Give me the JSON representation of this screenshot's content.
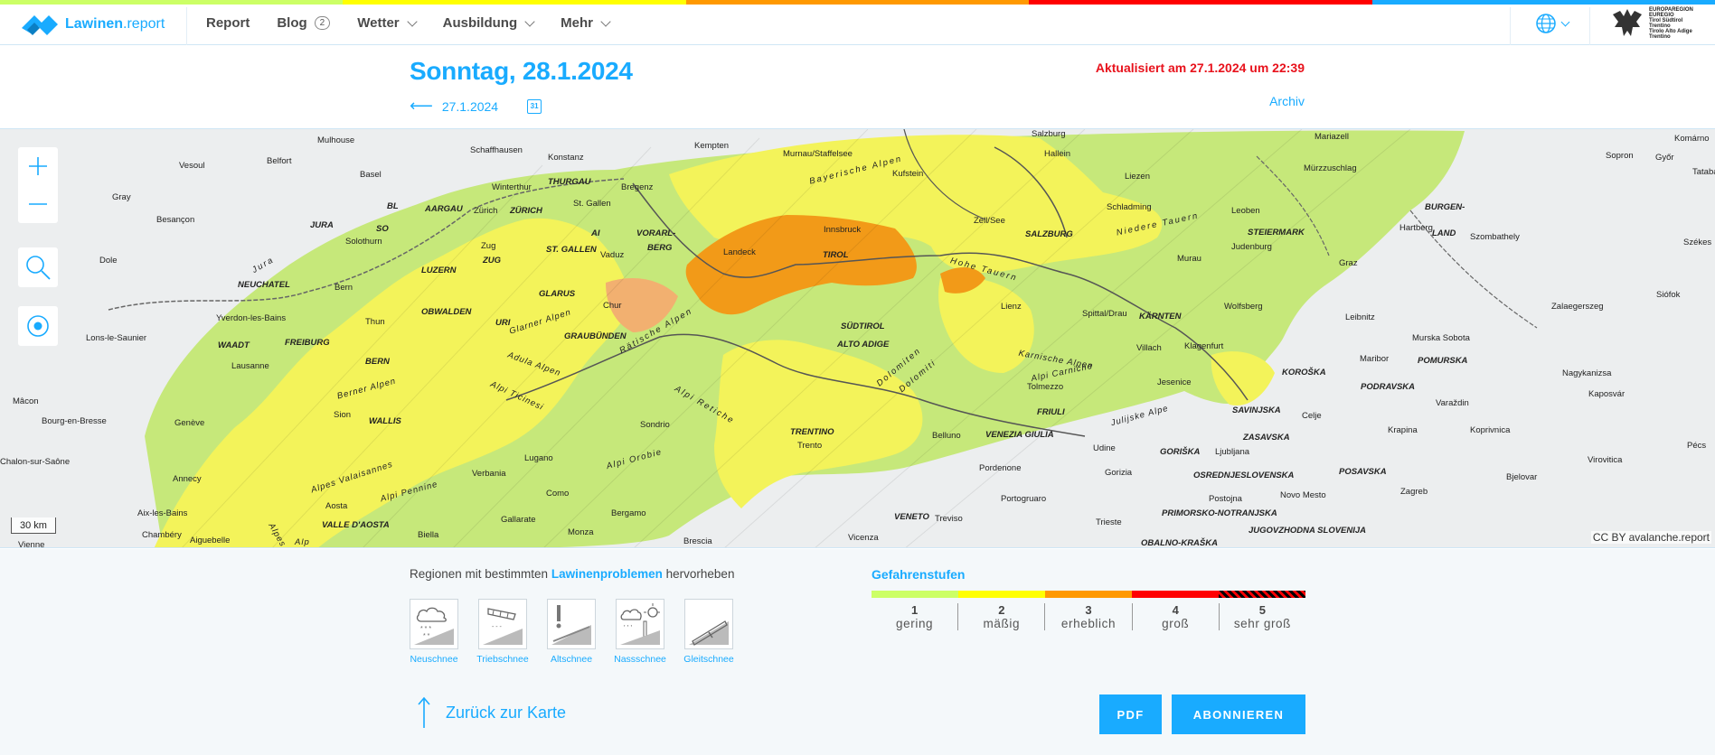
{
  "header": {
    "logo_text_main": "Lawinen",
    "logo_text_suffix": ".report",
    "nav": [
      {
        "label": "Report"
      },
      {
        "label": "Blog",
        "badge": "2"
      },
      {
        "label": "Wetter"
      },
      {
        "label": "Ausbildung"
      },
      {
        "label": "Mehr"
      }
    ],
    "strip_colors": [
      "#ccff66",
      "#ffff00",
      "#ff9900",
      "#ff0000",
      "#19abff"
    ],
    "language_icon": "globe-icon",
    "euregio_text": [
      "EUROPAREGION",
      "EUREGIO",
      "Tirol Südtirol Trentino",
      "Tirolo Alto Adige Trentino"
    ]
  },
  "report": {
    "date_title": "Sonntag, 28.1.2024",
    "prev_date": "27.1.2024",
    "calendar_day": "31",
    "updated": "Aktualisiert am 27.1.2024 um 22:39",
    "archive": "Archiv"
  },
  "map": {
    "scale": "30 km",
    "attribution": "CC BY avalanche.report",
    "labels": {
      "mulhouse": "Mulhouse",
      "belfort": "Belfort",
      "vesoul": "Vesoul",
      "basel": "Basel",
      "schaffhausen": "Schaffhausen",
      "konstanz": "Konstanz",
      "kempten": "Kempten",
      "murnau": "Murnau/Staffelsee",
      "salzburg": "Salzburg",
      "hallein": "Hallein",
      "mariazell": "Mariazell",
      "komarno": "Komárno",
      "gray": "Gray",
      "bl": "BL",
      "aargau": "AARGAU",
      "zurich": "Zürich",
      "zurich_c": "ZÜRICH",
      "winterthur": "Winterthur",
      "thurgau": "THURGAU",
      "bregenz": "Bregenz",
      "kufstein": "Kufstein",
      "liezen": "Liezen",
      "murzzuschlag": "Mürzzuschlag",
      "sopron": "Sopron",
      "gyor": "Győr",
      "tatab": "Tataba",
      "besancon": "Besançon",
      "jura": "JURA",
      "so": "SO",
      "solothurn": "Solothurn",
      "sankt_gallen": "St. Gallen",
      "ai": "AI",
      "vorarlberg": "VORARL-",
      "berg": "BERG",
      "innsbruck": "Innsbruck",
      "schladming": "Schladming",
      "leoben": "Leoben",
      "burgen": "BURGEN-",
      "land": "LAND",
      "hartberg": "Hartberg",
      "szombathely": "Szombathely",
      "zellamsee": "Zell/See",
      "salzburg_c": "SALZBURG",
      "steiermark": "STEIERMARK",
      "dole": "Dole",
      "luzern": "LUZERN",
      "zug": "Zug",
      "zug_c": "ZUG",
      "st_gallen_c": "ST. GALLEN",
      "vaduz": "Vaduz",
      "landeck": "Landeck",
      "tirol": "TIROL",
      "judenburg": "Judenburg",
      "murau": "Murau",
      "graz": "Graz",
      "szekes": "Székes",
      "neuchatel": "NEUCHATEL",
      "bern": "Bern",
      "glarus": "GLARUS",
      "chur": "Chur",
      "lienz": "Lienz",
      "spittal": "Spittal/Drau",
      "karnten": "KÄRNTEN",
      "wolfsberg": "Wolfsberg",
      "leibnitz": "Leibnitz",
      "siofok": "Siófok",
      "zalaegerszeg": "Zalaegerszeg",
      "yverdon": "Yverdon-les-Bains",
      "thun": "Thun",
      "obwalden": "OBWALDEN",
      "uri": "URI",
      "graubunden": "GRAUBÜNDEN",
      "sudtirol": "SÜDTIROL",
      "alto_adige": "ALTO ADIGE",
      "villach": "Villach",
      "klagenfurt": "Klagenfurt",
      "maribor": "Maribor",
      "murska": "Murska Sobota",
      "lons": "Lons-le-Saunier",
      "waadt": "WAADT",
      "freiburg": "FREIBURG",
      "bern_c": "BERN",
      "pomurska": "POMURSKA",
      "nagykanizsa": "Nagykanizsa",
      "lausanne": "Lausanne",
      "jesenice": "Jesenice",
      "koroska": "KOROŠKA",
      "podravska": "PODRAVSKA",
      "kaposvar": "Kaposvár",
      "macon": "Mâcon",
      "sion": "Sion",
      "wallis": "WALLIS",
      "tolmezzo": "Tolmezzo",
      "friuli": "FRIULI",
      "savinjska": "SAVINJSKA",
      "celje": "Celje",
      "varazdin": "Varaždin",
      "bourg": "Bourg-en-Bresse",
      "geneve": "Genève",
      "sondrio": "Sondrio",
      "trentino": "TRENTINO",
      "trento": "Trento",
      "belluno": "Belluno",
      "venezia_giulia": "VENEZIA GIULIA",
      "udine": "Udine",
      "zasavska": "ZASAVSKA",
      "krapina": "Krapina",
      "koprivnica": "Koprivnica",
      "pecs": "Pécs",
      "chalon": "Chalon-sur-Saône",
      "annecy": "Annecy",
      "lugano": "Lugano",
      "verbania": "Verbania",
      "pordenone": "Pordenone",
      "gorizia": "Gorizia",
      "goriska": "GORIŠKA",
      "ljubljana": "Ljubljana",
      "osrednjeslovenska": "OSREDNJESLOVENSKA",
      "posavska": "POSAVSKA",
      "bjelovar": "Bjelovar",
      "virovitica": "Virovitica",
      "aix": "Aix-les-Bains",
      "aosta": "Aosta",
      "como": "Como",
      "portogruaro": "Portogruaro",
      "novo_mesto": "Novo Mesto",
      "zagreb": "Zagreb",
      "chambery": "Chambéry",
      "aiguebelle": "Aiguebelle",
      "valle": "VALLE D'AOSTA",
      "bergamo": "Bergamo",
      "gallarate": "Gallarate",
      "veneto": "VENETO",
      "treviso": "Treviso",
      "trieste": "Trieste",
      "postojna": "Postojna",
      "primorsko": "PRIMORSKO-NOTRANJSKA",
      "jugovzhodna": "JUGOVZHODNA SLOVENIJA",
      "vienne": "Vienne",
      "biella": "Biella",
      "monza": "Monza",
      "brescia": "Brescia",
      "vicenza": "Vicenza",
      "obalno": "OBALNO-KRAŠKA",
      "bayerische": "Bayerische Alpen",
      "niedere": "Niedere Tauern",
      "hohe": "Hohe Tauern",
      "jura_r": "Jura",
      "berner": "Berner Alpen",
      "glarner": "Glarner Alpen",
      "adula": "Adula Alpen",
      "ratische": "Rätische Alpen",
      "ticinesi": "Alpi Ticinesi",
      "retiche": "Alpi Retiche",
      "orobie": "Alpi Orobie",
      "dolomiten": "Dolomiten",
      "dolomiti": "Dolomiti",
      "karnische": "Karnische Alpen",
      "carniche": "Alpi Carniche",
      "julijske": "Julijske Alpe",
      "valaisannes": "Alpes Valaisannes",
      "pennine": "Alpi Pennine",
      "alpes": "Alpes",
      "alp": "Alp"
    }
  },
  "problems": {
    "title_prefix": "Regionen mit bestimmten",
    "title_highlight": "Lawinenproblemen",
    "title_suffix": "hervorheben",
    "items": [
      {
        "label": "Neuschnee",
        "icon": "new-snow-icon"
      },
      {
        "label": "Triebschnee",
        "icon": "wind-slab-icon"
      },
      {
        "label": "Altschnee",
        "icon": "persistent-weak-layer-icon"
      },
      {
        "label": "Nassschnee",
        "icon": "wet-snow-icon"
      },
      {
        "label": "Gleitschnee",
        "icon": "gliding-snow-icon"
      }
    ]
  },
  "danger_scale": {
    "title": "Gefahrenstufen",
    "levels": [
      {
        "num": "1",
        "label": "gering",
        "color": "#ccff66"
      },
      {
        "num": "2",
        "label": "mäßig",
        "color": "#ffff00"
      },
      {
        "num": "3",
        "label": "erheblich",
        "color": "#ff9900"
      },
      {
        "num": "4",
        "label": "groß",
        "color": "#ff0000"
      },
      {
        "num": "5",
        "label": "sehr groß",
        "color": "#000000"
      }
    ]
  },
  "footer": {
    "back": "Zurück zur Karte",
    "pdf": "PDF",
    "subscribe": "ABONNIEREN"
  }
}
